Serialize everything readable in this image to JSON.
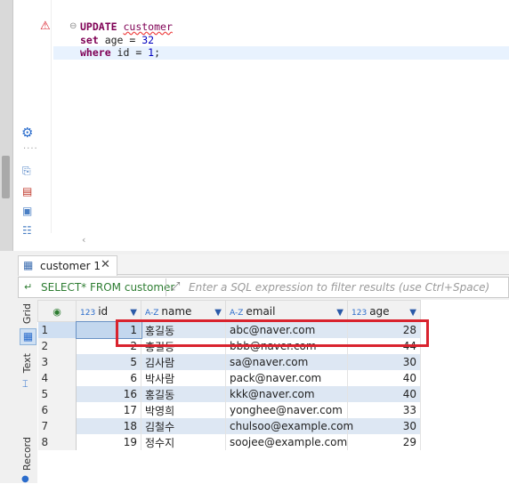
{
  "editor": {
    "line1": {
      "keyword": "UPDATE",
      "table": "customer"
    },
    "line2": {
      "keyword": "set",
      "rest": " age = ",
      "value": "32"
    },
    "line3": {
      "keyword": "where",
      "rest": " id = ",
      "value": "1",
      "end": ";"
    }
  },
  "result_tab": {
    "label": "customer 1"
  },
  "filter": {
    "query": "SELECT* FROM customer",
    "placeholder": "Enter a SQL expression to filter results (use Ctrl+Space)"
  },
  "side_tabs": {
    "grid": "Grid",
    "text": "Text",
    "record": "Record"
  },
  "grid": {
    "columns": [
      {
        "type": "123",
        "name": "id"
      },
      {
        "type": "A-Z",
        "name": "name"
      },
      {
        "type": "A-Z",
        "name": "email"
      },
      {
        "type": "123",
        "name": "age"
      }
    ],
    "rows": [
      {
        "num": "1",
        "id": "1",
        "name": "홍길동",
        "email": "abc@naver.com",
        "age": "28"
      },
      {
        "num": "2",
        "id": "2",
        "name": "홍길동",
        "email": "bbb@naver.com",
        "age": "44"
      },
      {
        "num": "3",
        "id": "5",
        "name": "김사람",
        "email": "sa@naver.com",
        "age": "30"
      },
      {
        "num": "4",
        "id": "6",
        "name": "박사람",
        "email": "pack@naver.com",
        "age": "40"
      },
      {
        "num": "5",
        "id": "16",
        "name": "홍길동",
        "email": "kkk@naver.com",
        "age": "40"
      },
      {
        "num": "6",
        "id": "17",
        "name": "박영희",
        "email": "yonghee@naver.com",
        "age": "33"
      },
      {
        "num": "7",
        "id": "18",
        "name": "김철수",
        "email": "chulsoo@example.com",
        "age": "30"
      },
      {
        "num": "8",
        "id": "19",
        "name": "정수지",
        "email": "soojee@example.com",
        "age": "29"
      }
    ]
  },
  "colors": {
    "highlight": "#d9232e",
    "keyword": "#7f0055",
    "number": "#0000c0",
    "row_alt": "#dde7f3"
  }
}
